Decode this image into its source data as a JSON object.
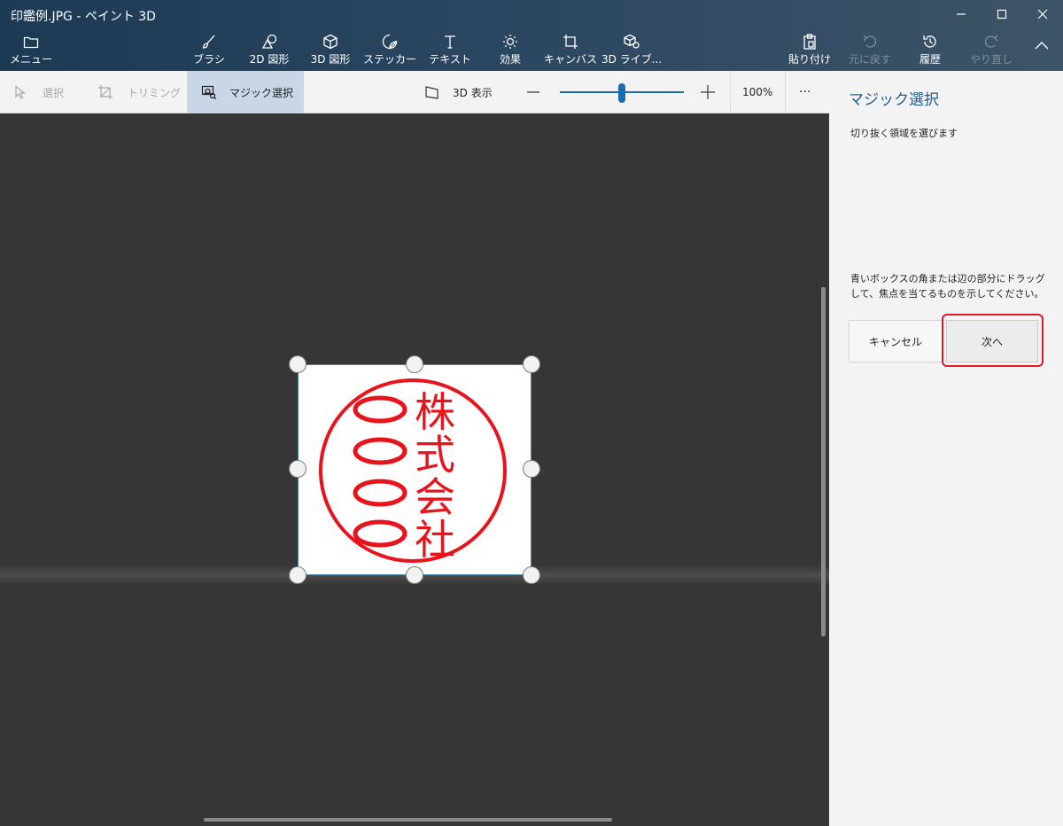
{
  "window": {
    "title": "印鑑例.JPG - ペイント 3D"
  },
  "ribbon": {
    "menu": "メニュー",
    "tools": [
      "ブラシ",
      "2D 図形",
      "3D 図形",
      "ステッカー",
      "テキスト",
      "効果",
      "キャンバス",
      "3D ライブ..."
    ],
    "paste": "貼り付け",
    "undo": "元に戻す",
    "history": "履歴",
    "redo": "やり直し"
  },
  "subbar": {
    "select": "選択",
    "trim": "トリミング",
    "magic_select": "マジック選択",
    "view_3d": "3D 表示",
    "zoom_value": "100%",
    "zoom_slider_fraction": 0.5,
    "more": "···"
  },
  "panel": {
    "title": "マジック選択",
    "subtitle": "切り抜く領域を選びます",
    "info": "青いボックスの角または辺の部分にドラッグして、焦点を当てるものを示してください。",
    "cancel": "キャンセル",
    "next": "次へ"
  },
  "stamp": {
    "left_column": "〇〇〇〇",
    "right_column": "株式会社",
    "color": "#e8141c"
  },
  "colors": {
    "accent": "#1e5f8a",
    "highlight": "#e01b24",
    "slider": "#1a6bb0"
  }
}
